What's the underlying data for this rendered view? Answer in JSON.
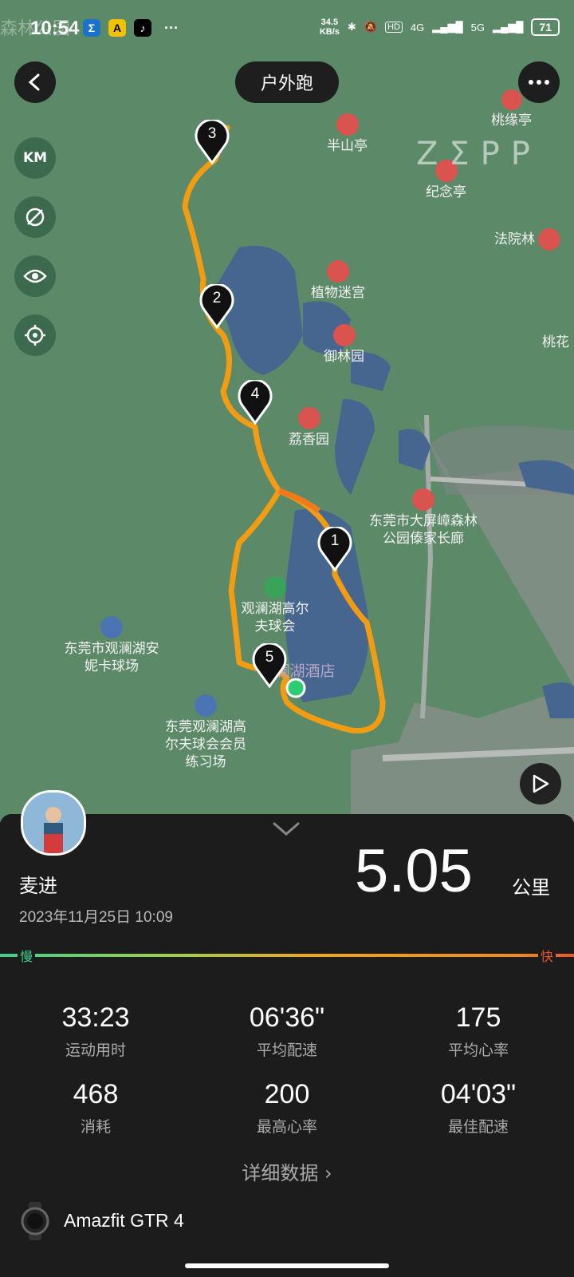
{
  "status_bar": {
    "time": "10:54",
    "ghost_text": "森林公园",
    "speed_value": "34.5",
    "speed_unit": "KB/s",
    "battery": "71",
    "network1": "4G",
    "network2": "5G"
  },
  "header": {
    "title": "户外跑",
    "back_icon": "back-arrow-icon",
    "more_icon": "more-dots-icon"
  },
  "map_controls": {
    "unit_label": "KM"
  },
  "map": {
    "watermark": "ZΣPP",
    "pois": [
      {
        "label": "桃缘亭"
      },
      {
        "label": "半山亭"
      },
      {
        "label": "纪念亭"
      },
      {
        "label": "法院林"
      },
      {
        "label": "植物迷宫"
      },
      {
        "label": "御林园"
      },
      {
        "label": "荔香园"
      },
      {
        "label": "桃花"
      },
      {
        "label": "东莞市大屏嶂森林公园傣家长廊"
      },
      {
        "label": "观澜湖高尔夫球会"
      },
      {
        "label": "东莞市观澜湖安妮卡球场"
      },
      {
        "label": "观澜湖酒店"
      },
      {
        "label": "东莞观澜湖高尔夫球会会员练习场"
      }
    ],
    "km_markers": [
      "1",
      "2",
      "3",
      "4",
      "5"
    ]
  },
  "summary": {
    "user_name": "麦进",
    "date": "2023年11月25日 10:09",
    "distance": "5.05",
    "distance_unit": "公里",
    "pace_slow": "慢",
    "pace_fast": "快"
  },
  "stats": [
    {
      "value": "33:23",
      "label": "运动用时"
    },
    {
      "value": "06'36\"",
      "label": "平均配速"
    },
    {
      "value": "175",
      "label": "平均心率"
    },
    {
      "value": "468",
      "label": "消耗"
    },
    {
      "value": "200",
      "label": "最高心率"
    },
    {
      "value": "04'03\"",
      "label": "最佳配速"
    }
  ],
  "details_label": "详细数据",
  "device_name": "Amazfit GTR 4",
  "colors": {
    "route": "#f39c12",
    "map_bg": "#5c8a69",
    "water": "#46658f",
    "panel": "#1c1c1c"
  }
}
